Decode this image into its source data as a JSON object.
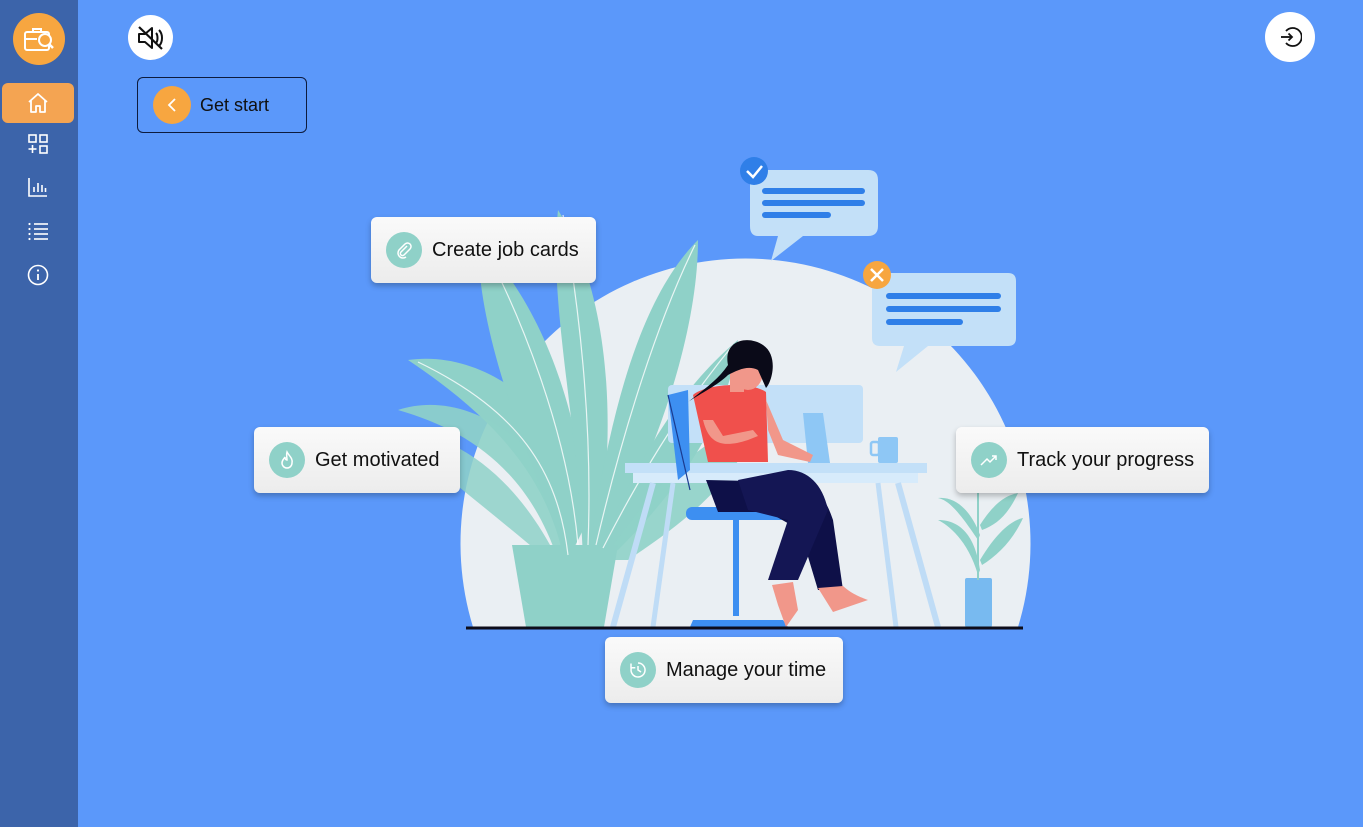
{
  "sidebar": {
    "logo_icon": "briefcase-search-icon",
    "items": [
      {
        "icon": "home-icon",
        "active": true
      },
      {
        "icon": "dashboard-add-icon",
        "active": false
      },
      {
        "icon": "bar-chart-icon",
        "active": false
      },
      {
        "icon": "list-icon",
        "active": false
      },
      {
        "icon": "info-icon",
        "active": false
      }
    ]
  },
  "header": {
    "mute_icon": "volume-mute-icon",
    "logout_icon": "logout-icon"
  },
  "get_start": {
    "label": "Get start",
    "icon": "chevron-left-icon"
  },
  "features": {
    "create": {
      "label": "Create job cards",
      "icon": "paperclip-icon"
    },
    "motivated": {
      "label": "Get motivated",
      "icon": "flame-icon"
    },
    "progress": {
      "label": "Track your progress",
      "icon": "trending-up-icon"
    },
    "time": {
      "label": "Manage your time",
      "icon": "clock-icon"
    }
  },
  "colors": {
    "background": "#5b98fa",
    "sidebar": "#3c64aa",
    "accent": "#f7a640",
    "feature_icon_bg": "#8fd1c8"
  }
}
